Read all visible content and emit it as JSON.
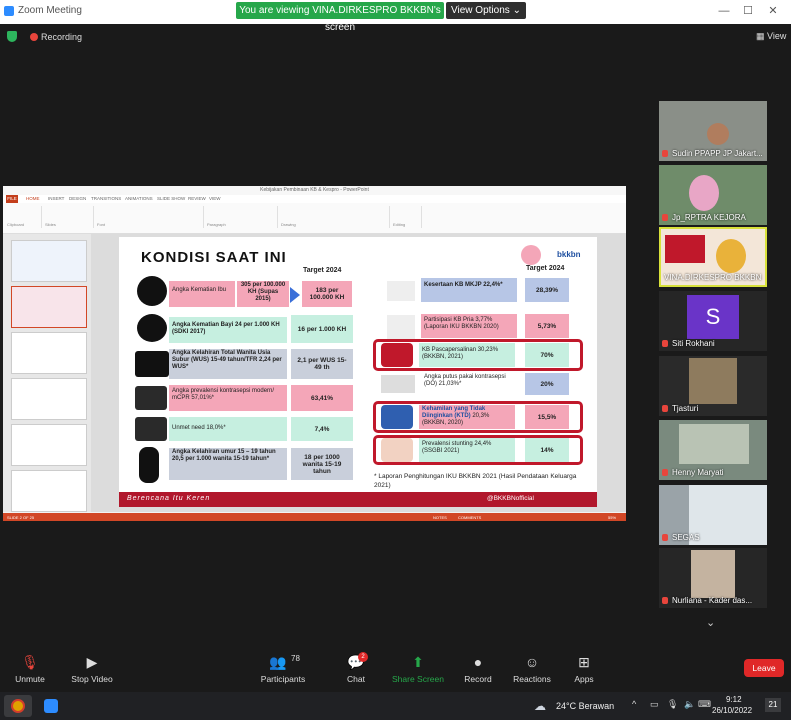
{
  "window": {
    "title": "Zoom Meeting",
    "viewing_banner": "You are viewing VINA.DIRKESPRO BKKBN's screen",
    "view_options": "View Options",
    "view_btn": "View"
  },
  "status": {
    "recording": "Recording"
  },
  "ppt": {
    "title": "Kebijakan Pembinaan KB & Kespro - PowerPoint",
    "file_tab": "FILE",
    "tabs": [
      "HOME",
      "INSERT",
      "DESIGN",
      "TRANSITIONS",
      "ANIMATIONS",
      "SLIDE SHOW",
      "REVIEW",
      "VIEW"
    ],
    "ribbon_groups": [
      "Clipboard",
      "Slides",
      "Font",
      "Paragraph",
      "Drawing",
      "Editing"
    ],
    "status_left": "SLIDE 2 OF 25",
    "status_notes": "NOTES",
    "status_comments": "COMMENTS",
    "zoom": "55%"
  },
  "slide": {
    "title": "KONDISI SAAT INI",
    "brand": "bkkbn",
    "target_header_left": "Target 2024",
    "target_header_right": "Target 2024",
    "left_rows": [
      {
        "label": "Angka Kematian Ibu",
        "current": "305 per 100.000 KH (Supas 2015)",
        "target": "183 per 100.000 KH"
      },
      {
        "label": "Angka Kematian Bayi 24 per 1.000 KH (SDKI 2017)",
        "target": "16 per 1.000 KH"
      },
      {
        "label": "Angka Kelahiran Total Wanita Usia Subur (WUS) 15-49 tahun/TFR 2,24 per WUS*",
        "target": "2,1 per WUS 15-49 th"
      },
      {
        "label": "Angka prevalensi kontrasepsi modern/ mCPR 57,01%*",
        "target": "63,41%"
      },
      {
        "label": "Unmet need 18,0%*",
        "target": "7,4%"
      },
      {
        "label": "Angka Kelahiran umur 15 – 19 tahun 20,5 per 1.000 wanita 15-19 tahun*",
        "target": "18 per 1000 wanita 15-19 tahun"
      }
    ],
    "right_rows": [
      {
        "label": "Kesertaan KB MKJP 22,4%*",
        "target": "28,39%"
      },
      {
        "label": "Partisipasi KB Pria 3,77% (Laporan IKU BKKBN 2020)",
        "target": "5,73%"
      },
      {
        "label": "KB Pascapersalinan 30,23% (BKKBN, 2021)",
        "target": "70%"
      },
      {
        "label": "Angka putus pakai kontrasepsi (DO) 21,03%*",
        "target": "20%"
      },
      {
        "label_a": "Kehamilan yang Tidak Diinginkan (KTD)",
        "label_b": " 20,3% (BKKBN, 2020)",
        "target": "15,5%"
      },
      {
        "label": "Prevalensi stunting 24,4% (SSGBI 2021)",
        "target": "14%"
      }
    ],
    "footnote": "* Laporan Penghitungan IKU BKKBN 2021 (Hasil Pendataan Keluarga 2021)",
    "footer_text": "Berencana Itu Keren",
    "footer_social": "@BKKBNofficial"
  },
  "participants": [
    {
      "name": "Sudin PPAPP JP Jakart..."
    },
    {
      "name": "Jp_RPTRA KEJORA"
    },
    {
      "name": "VINA.DIRKESPRO BKKBN"
    },
    {
      "name": "Siti Rokhani",
      "initial": "S"
    },
    {
      "name": "Tjasturi"
    },
    {
      "name": "Henny Maryati"
    },
    {
      "name": "SEGAS"
    },
    {
      "name": "Nurliana - Kader das..."
    }
  ],
  "toolbar": {
    "unmute": "Unmute",
    "stop_video": "Stop Video",
    "participants": "Participants",
    "participants_count": "78",
    "chat": "Chat",
    "chat_badge": "2",
    "share_screen": "Share Screen",
    "record": "Record",
    "reactions": "Reactions",
    "apps": "Apps",
    "leave": "Leave"
  },
  "taskbar": {
    "weather": "24°C  Berawan",
    "time": "9:12",
    "date": "26/10/2022",
    "notif": "21"
  },
  "colors": {
    "zoom_green": "#26a74a",
    "leave_red": "#e02828",
    "bkkbn_red": "#b1172c",
    "pink": "#f4a6b8",
    "mint": "#c6efe0"
  }
}
